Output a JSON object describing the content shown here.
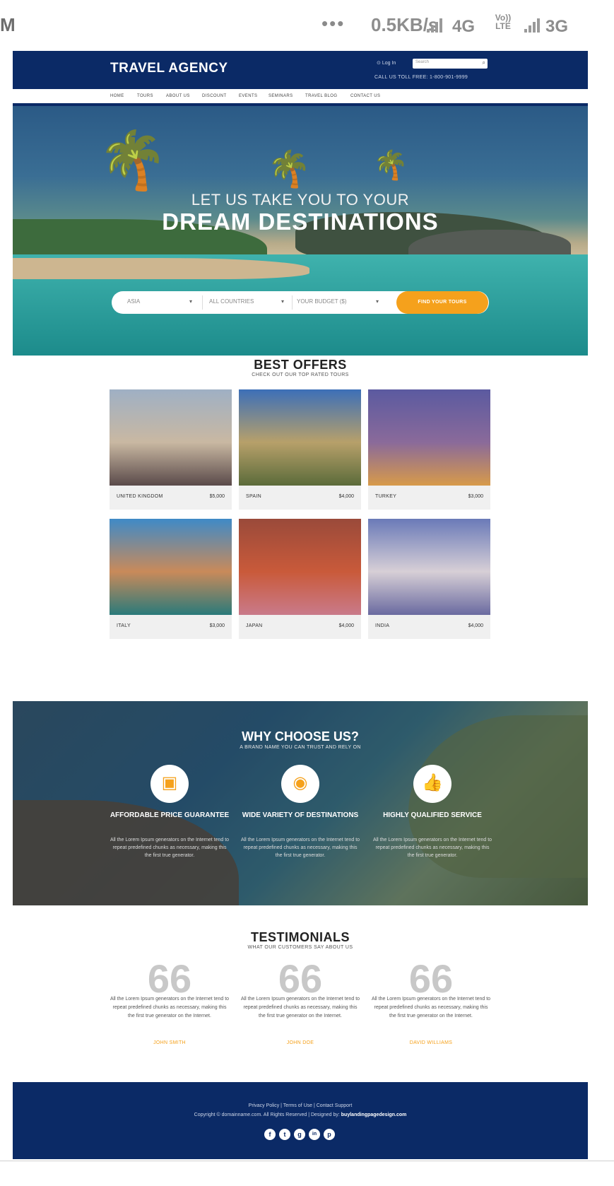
{
  "status_bar": {
    "clock": "M",
    "dots": "•••",
    "speed": "0.5KB/s",
    "net_4g": "4G",
    "volte": "Vo)) LTE",
    "net_3g": "3G"
  },
  "header": {
    "brand": "TRAVEL AGENCY",
    "login": "Log In",
    "search_placeholder": "Search",
    "call_us": "CALL US TOLL FREE: 1-800-901-9999"
  },
  "nav": {
    "items": [
      "HOME",
      "TOURS",
      "ABOUT US",
      "DISCOUNT",
      "EVENTS",
      "SEMINARS",
      "TRAVEL BLOG",
      "CONTACT US"
    ]
  },
  "hero": {
    "tagline": "LET US TAKE YOU TO YOUR",
    "headline": "DREAM DESTINATIONS",
    "region": "ASIA",
    "country": "ALL COUNTRIES",
    "budget": "YOUR BUDGET ($)",
    "find_button": "FIND YOUR TOURS"
  },
  "offers": {
    "title": "BEST OFFERS",
    "subtitle": "CHECK OUT OUR TOP RATED TOURS",
    "cards": [
      {
        "name": "UNITED KINGDOM",
        "price": "$5,000",
        "colors": [
          "#9fb0c4",
          "#c9b8a2",
          "#5a4a4a"
        ]
      },
      {
        "name": "SPAIN",
        "price": "$4,000",
        "colors": [
          "#3c6fb8",
          "#b7a06a",
          "#5b6b3a"
        ]
      },
      {
        "name": "TURKEY",
        "price": "$3,000",
        "colors": [
          "#5b5aa0",
          "#8a6a9a",
          "#d79a4a"
        ]
      },
      {
        "name": "ITALY",
        "price": "$3,000",
        "colors": [
          "#3f8ac7",
          "#c98a5a",
          "#2a7a7a"
        ]
      },
      {
        "name": "JAPAN",
        "price": "$4,000",
        "colors": [
          "#9a4a3a",
          "#c95a3a",
          "#c97a8a"
        ]
      },
      {
        "name": "INDIA",
        "price": "$4,000",
        "colors": [
          "#6a7ab8",
          "#d7cfd6",
          "#6a6aa0"
        ]
      }
    ]
  },
  "why": {
    "title": "WHY CHOOSE US?",
    "subtitle": "A BRAND NAME YOU CAN TRUST AND RELY ON",
    "features": [
      {
        "icon": "wallet-icon",
        "glyph": "▣",
        "title": "AFFORDABLE PRICE GUARANTEE",
        "desc": "All the Lorem Ipsum generators on the Internet tend to repeat predefined chunks as necessary, making this the first true generator."
      },
      {
        "icon": "globe-icon",
        "glyph": "◉",
        "title": "WIDE VARIETY OF DESTINATIONS",
        "desc": "All the Lorem Ipsum generators on the Internet tend to repeat predefined chunks as necessary, making this the first true generator."
      },
      {
        "icon": "thumbs-up-icon",
        "glyph": "👍",
        "title": "HIGHLY QUALIFIED SERVICE",
        "desc": "All the Lorem Ipsum generators on the Internet tend to repeat predefined chunks as necessary, making this the first true generator."
      }
    ]
  },
  "testimonials": {
    "title": "TESTIMONIALS",
    "subtitle": "WHAT OUR CUSTOMERS SAY ABOUT US",
    "quote_mark": "66",
    "items": [
      {
        "text": "All the Lorem Ipsum generators on the Internet tend to repeat predefined chunks as necessary, making this the first true generator on the Internet.",
        "author": "JOHN SMITH"
      },
      {
        "text": "All the Lorem Ipsum generators on the Internet tend to repeat predefined chunks as necessary, making this the first true generator on the Internet.",
        "author": "JOHN DOE"
      },
      {
        "text": "All the Lorem Ipsum generators on the Internet tend to repeat predefined chunks as necessary, making this the first true generator on the Internet.",
        "author": "DAVID WILLIAMS"
      }
    ]
  },
  "footer": {
    "links": "Privacy Policy  |  Terms of Use  |  Contact Support",
    "copyright": "Copyright © domainname.com. All Rights Reserved  |  Designed by:",
    "designer": "buylandingpagedesign.com",
    "socials": [
      "f",
      "t",
      "g",
      "in",
      "p"
    ]
  }
}
